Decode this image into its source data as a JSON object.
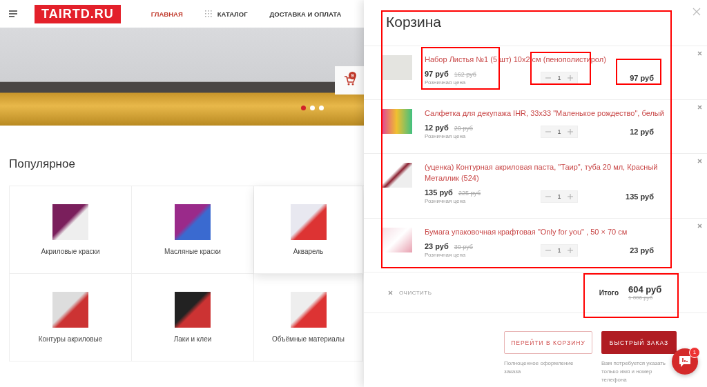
{
  "header": {
    "logo": "TAIRTD.RU",
    "nav": [
      {
        "label": "ГЛАВНАЯ",
        "selected": true,
        "kind": "link"
      },
      {
        "label": "КАТАЛОГ",
        "selected": false,
        "kind": "catalog"
      },
      {
        "label": "ДОСТАВКА И ОПЛАТА",
        "selected": false,
        "kind": "link"
      }
    ]
  },
  "hero": {
    "slides": [
      {
        "selected": true
      },
      {
        "selected": false
      },
      {
        "selected": false
      }
    ],
    "cart_badge": "9"
  },
  "popular": {
    "title": "Популярное",
    "categories": [
      {
        "label": "Акриловые краски",
        "selected": false
      },
      {
        "label": "Масляные краски",
        "selected": false
      },
      {
        "label": "Акварель",
        "selected": true
      },
      {
        "label": "Контуры акриловые",
        "selected": false
      },
      {
        "label": "Лаки и клеи",
        "selected": false
      },
      {
        "label": "Объёмные материалы",
        "selected": false
      }
    ]
  },
  "cart": {
    "title": "Корзина",
    "items": [
      {
        "name": "Набор Листья №1 (5 шт) 10х2 см (пенополистирол)",
        "price": "97 руб",
        "old_price": "162 руб",
        "price_note": "Розничная цена",
        "quantity": "1",
        "total": "97 руб"
      },
      {
        "name": "Салфетка для декупажа IHR, 33х33 \"Маленькое рождество\", белый",
        "price": "12 руб",
        "old_price": "20 руб",
        "price_note": "Розничная цена",
        "quantity": "1",
        "total": "12 руб"
      },
      {
        "name": "(уценка) Контурная акриловая паста, \"Таир\", туба 20 мл, Красный Металлик (524)",
        "price": "135 руб",
        "old_price": "225 руб",
        "price_note": "Розничная цена",
        "quantity": "1",
        "total": "135 руб"
      },
      {
        "name": "Бумага упаковочная крафтовая \"Only for you\" , 50 × 70 см",
        "price": "23 руб",
        "old_price": "30 руб",
        "price_note": "Розничная цена",
        "quantity": "1",
        "total": "23 руб"
      }
    ],
    "clear": "ОЧИСТИТЬ",
    "total_label": "Итого",
    "total": "604 руб",
    "old_total": "1 006 руб",
    "actions": [
      {
        "label": "ПЕРЕЙТИ В КОРЗИНУ",
        "kind": "outline",
        "note": "Полноценное оформление заказа"
      },
      {
        "label": "БЫСТРЫЙ ЗАКАЗ",
        "kind": "filled",
        "note": "Вам потребуется указать только имя и номер телефона"
      }
    ]
  },
  "chat": {
    "badge": "1"
  },
  "annotations": [
    {
      "kind": "frame"
    },
    {
      "kind": "frame"
    },
    {
      "kind": "frame"
    },
    {
      "kind": "frame"
    },
    {
      "kind": "frame"
    }
  ]
}
